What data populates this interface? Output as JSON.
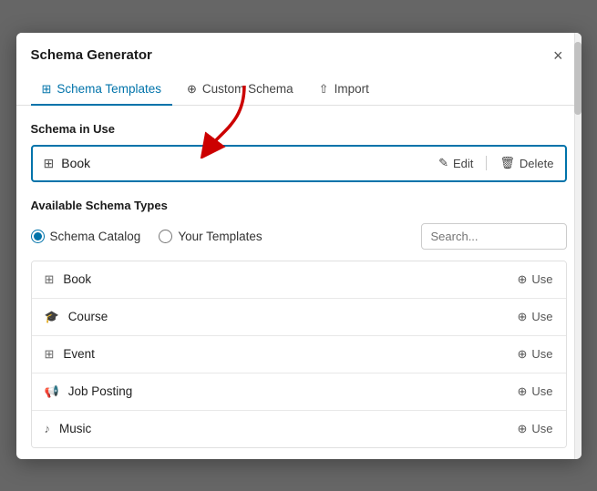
{
  "dialog": {
    "title": "Schema Generator",
    "close_label": "×"
  },
  "tabs": [
    {
      "id": "schema-templates",
      "label": "Schema Templates",
      "active": true
    },
    {
      "id": "custom-schema",
      "label": "Custom Schema",
      "active": false
    },
    {
      "id": "import",
      "label": "Import",
      "active": false
    }
  ],
  "schema_in_use": {
    "section_label": "Schema in Use",
    "name": "Book",
    "edit_label": "Edit",
    "delete_label": "Delete"
  },
  "available": {
    "section_label": "Available Schema Types",
    "filters": [
      {
        "id": "catalog",
        "label": "Schema Catalog",
        "checked": true
      },
      {
        "id": "templates",
        "label": "Your Templates",
        "checked": false
      }
    ],
    "search_placeholder": "Search...",
    "items": [
      {
        "name": "Book"
      },
      {
        "name": "Course"
      },
      {
        "name": "Event"
      },
      {
        "name": "Job Posting"
      },
      {
        "name": "Music"
      }
    ],
    "use_label": "Use"
  }
}
